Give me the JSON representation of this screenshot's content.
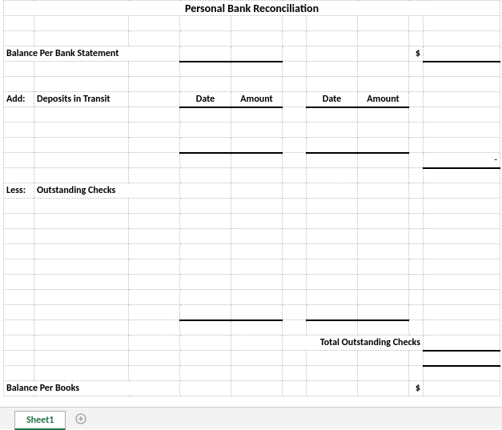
{
  "title": "Personal Bank Reconciliation",
  "labels": {
    "balance_per_bank": "Balance Per Bank Statement",
    "currency": "$",
    "add": "Add:",
    "deposits_in_transit": "Deposits in Transit",
    "date": "Date",
    "amount": "Amount",
    "dash": "-",
    "less": "Less:",
    "outstanding_checks": "Outstanding Checks",
    "total_outstanding": "Total Outstanding Checks",
    "balance_per_books": "Balance Per Books"
  },
  "tabs": {
    "active": "Sheet1"
  }
}
